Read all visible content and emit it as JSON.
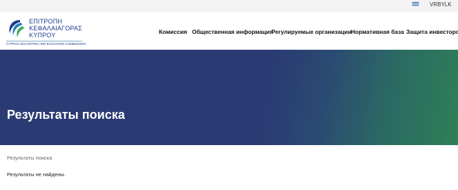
{
  "topbar": {
    "language_flag": "greek-flag-icon",
    "language_code": "VRBYLK"
  },
  "logo": {
    "line1": "ΕΠΙΤΡΟΠΗ",
    "line2": "ΚΕΦΑΛΑΙΑΓΟΡΑΣ",
    "line3": "ΚΥΠΡΟΥ",
    "subtitle": "CYPRUS SECURITIES AND EXCHANGE COMMISSION",
    "brand_color": "#1a3a8f"
  },
  "nav": {
    "items": [
      {
        "label": "Комиссия"
      },
      {
        "label": "Общественная информация"
      },
      {
        "label": "Регулируемые организации"
      },
      {
        "label": "Нормативная база"
      },
      {
        "label": "Защита инвесторов"
      }
    ]
  },
  "hero": {
    "title": "Результаты поиска",
    "colors": {
      "start": "#2a3b74",
      "end": "#2e7f57"
    }
  },
  "breadcrumb": {
    "current": "Результаты поиска"
  },
  "results": {
    "message": "Результаты не найдены."
  }
}
